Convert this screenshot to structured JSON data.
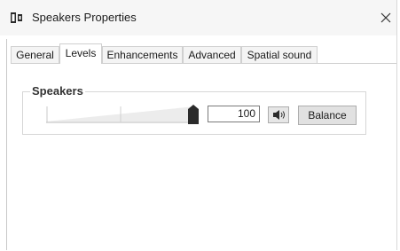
{
  "window": {
    "title": "Speakers Properties"
  },
  "tabs": [
    {
      "label": "General",
      "active": false
    },
    {
      "label": "Levels",
      "active": true
    },
    {
      "label": "Enhancements",
      "active": false
    },
    {
      "label": "Advanced",
      "active": false
    },
    {
      "label": "Spatial sound",
      "active": false
    }
  ],
  "levels": {
    "group_label": "Speakers",
    "volume_value": "100",
    "volume_level_fraction": 1.0,
    "balance_label": "Balance"
  },
  "icons": {
    "app": "speaker-icon",
    "close": "close-icon",
    "mute": "speaker-volume-icon"
  },
  "colors": {
    "titlebar_bg": "#f6f6f6",
    "slider_thumb": "#2b2b2b",
    "button_bg": "#e1e1e1"
  }
}
